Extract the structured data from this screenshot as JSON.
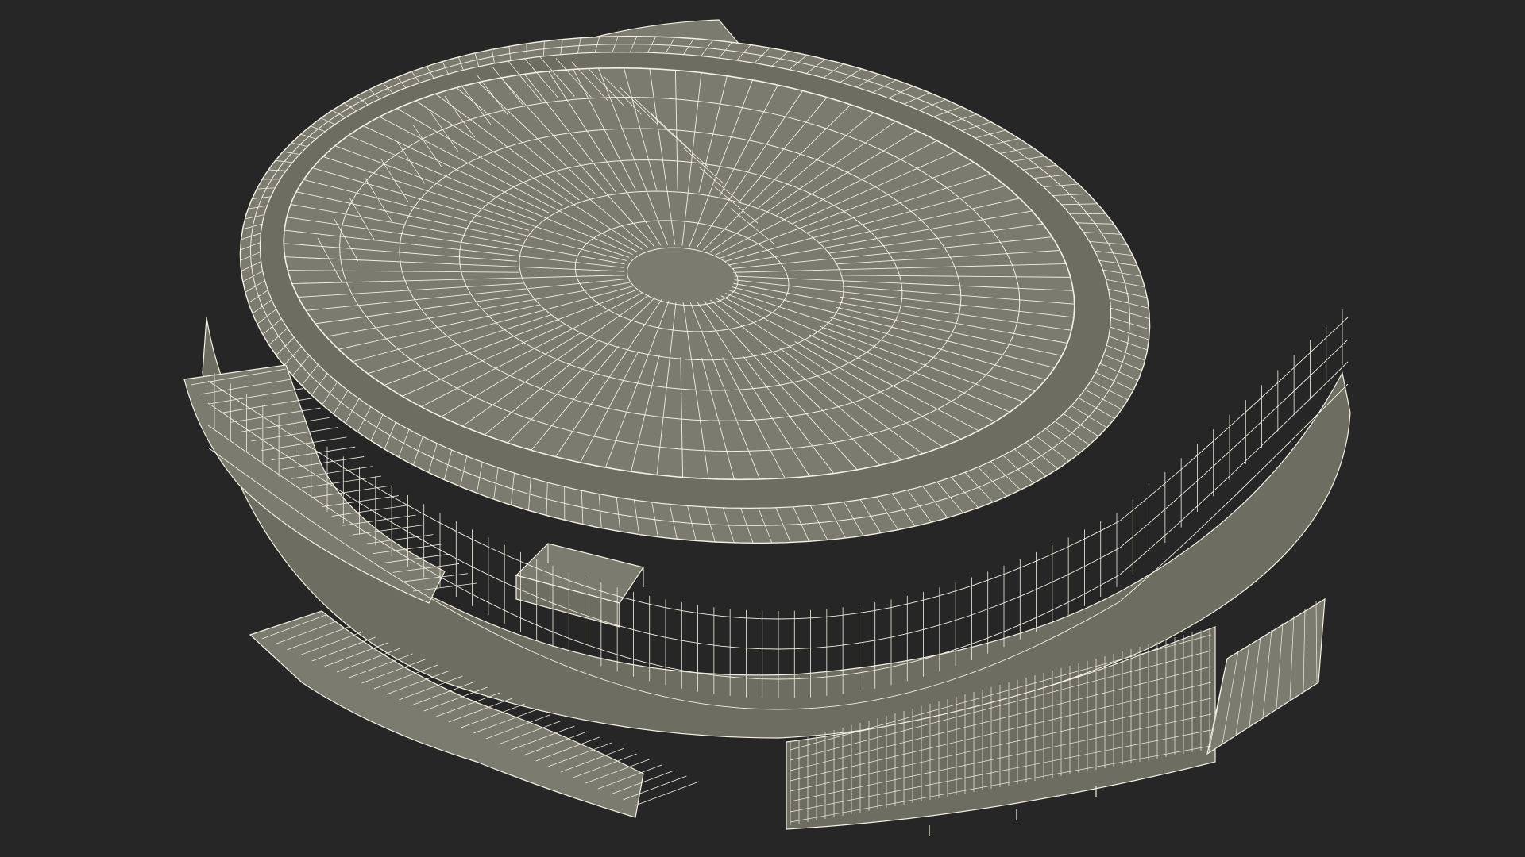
{
  "scene": {
    "background_color": "#262626",
    "surface_color": "#7c7b6f",
    "surface_dark_color": "#6e6d62",
    "wire_color": "#f4f1e3"
  }
}
